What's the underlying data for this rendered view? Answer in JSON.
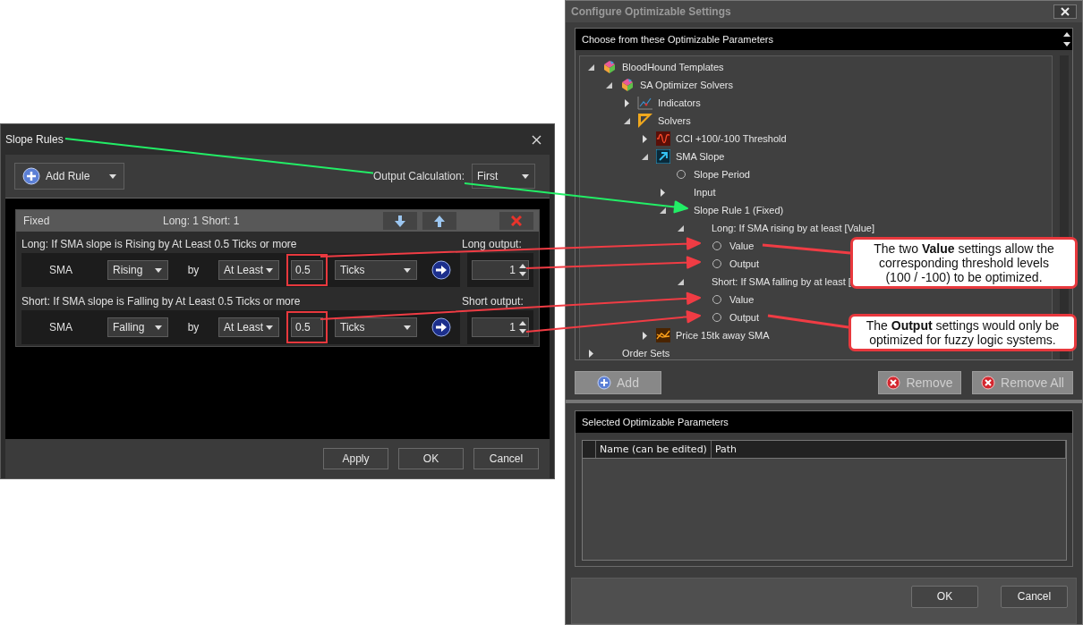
{
  "slope_rules": {
    "title": "Slope Rules",
    "add_rule": "Add Rule",
    "output_calculation_label": "Output Calculation:",
    "output_calculation": "First",
    "rule": {
      "name": "Fixed",
      "summary": "Long: 1 Short: 1",
      "conditions": [
        {
          "sentence": "Long: If SMA slope is Rising by At Least 0.5 Ticks or more",
          "output_label": "Long output:",
          "indicator": "SMA",
          "direction": "Rising",
          "by": "by",
          "comparison": "At Least",
          "value": "0.5",
          "highlighted": true,
          "unit": "Ticks",
          "output": "1"
        },
        {
          "sentence": "Short: If SMA slope is Falling by At Least 0.5 Ticks or more",
          "output_label": "Short output:",
          "indicator": "SMA",
          "direction": "Falling",
          "by": "by",
          "comparison": "At Least",
          "value": "0.5",
          "highlighted": true,
          "unit": "Ticks",
          "output": "1"
        }
      ]
    },
    "buttons": [
      "Apply",
      "OK",
      "Cancel"
    ]
  },
  "optimizable_settings": {
    "title": "Configure Optimizable Settings",
    "available_header": "Choose from these Optimizable Parameters",
    "tree": [
      {
        "label": "BloodHound Templates",
        "kind": "template",
        "expanded": true,
        "children": [
          {
            "label": "SA Optimizer Solvers",
            "kind": "template",
            "expanded": true,
            "children": [
              {
                "label": "Indicators",
                "kind": "indicators",
                "expanded": false
              },
              {
                "label": "Solvers",
                "kind": "solvers",
                "expanded": true,
                "children": [
                  {
                    "label": "CCI +100/-100 Threshold",
                    "kind": "cci",
                    "expanded": false
                  },
                  {
                    "label": "SMA Slope",
                    "kind": "sma",
                    "expanded": true,
                    "children": [
                      {
                        "label": "Slope Period",
                        "kind": "param",
                        "selected": false
                      },
                      {
                        "label": "Input",
                        "expanded": false
                      },
                      {
                        "label": "Slope Rule 1 (Fixed)",
                        "expanded": true,
                        "children": [
                          {
                            "label": "Long: If SMA rising by at least [Value]",
                            "expanded": true,
                            "children": [
                              {
                                "label": "Value",
                                "kind": "param",
                                "selected": false
                              },
                              {
                                "label": "Output",
                                "kind": "param",
                                "selected": false
                              }
                            ]
                          },
                          {
                            "label": "Short: If SMA falling by at least [",
                            "expanded": true,
                            "children": [
                              {
                                "label": "Value",
                                "kind": "param",
                                "selected": false
                              },
                              {
                                "label": "Output",
                                "kind": "param",
                                "selected": false
                              }
                            ]
                          }
                        ]
                      }
                    ]
                  },
                  {
                    "label": "Price 15tk away SMA",
                    "kind": "price",
                    "expanded": false
                  }
                ]
              }
            ]
          }
        ]
      },
      {
        "label": "Order Sets",
        "expanded": false
      }
    ],
    "actions": [
      {
        "label": "Add",
        "kind": "add",
        "disabled": true
      },
      {
        "label": "Remove",
        "kind": "remove",
        "disabled": true
      },
      {
        "label": "Remove All",
        "kind": "remove",
        "disabled": true
      }
    ],
    "selected_header": "Selected Optimizable Parameters",
    "columns": [
      "Name (can be edited)",
      "Path"
    ],
    "buttons": [
      "OK",
      "Cancel"
    ]
  },
  "callouts": [
    {
      "text": "The two **Value** settings allow the corresponding threshold levels (100 / -100) to be optimized."
    },
    {
      "text": "The **Output** settings would only be optimized for fuzzy logic systems."
    }
  ]
}
